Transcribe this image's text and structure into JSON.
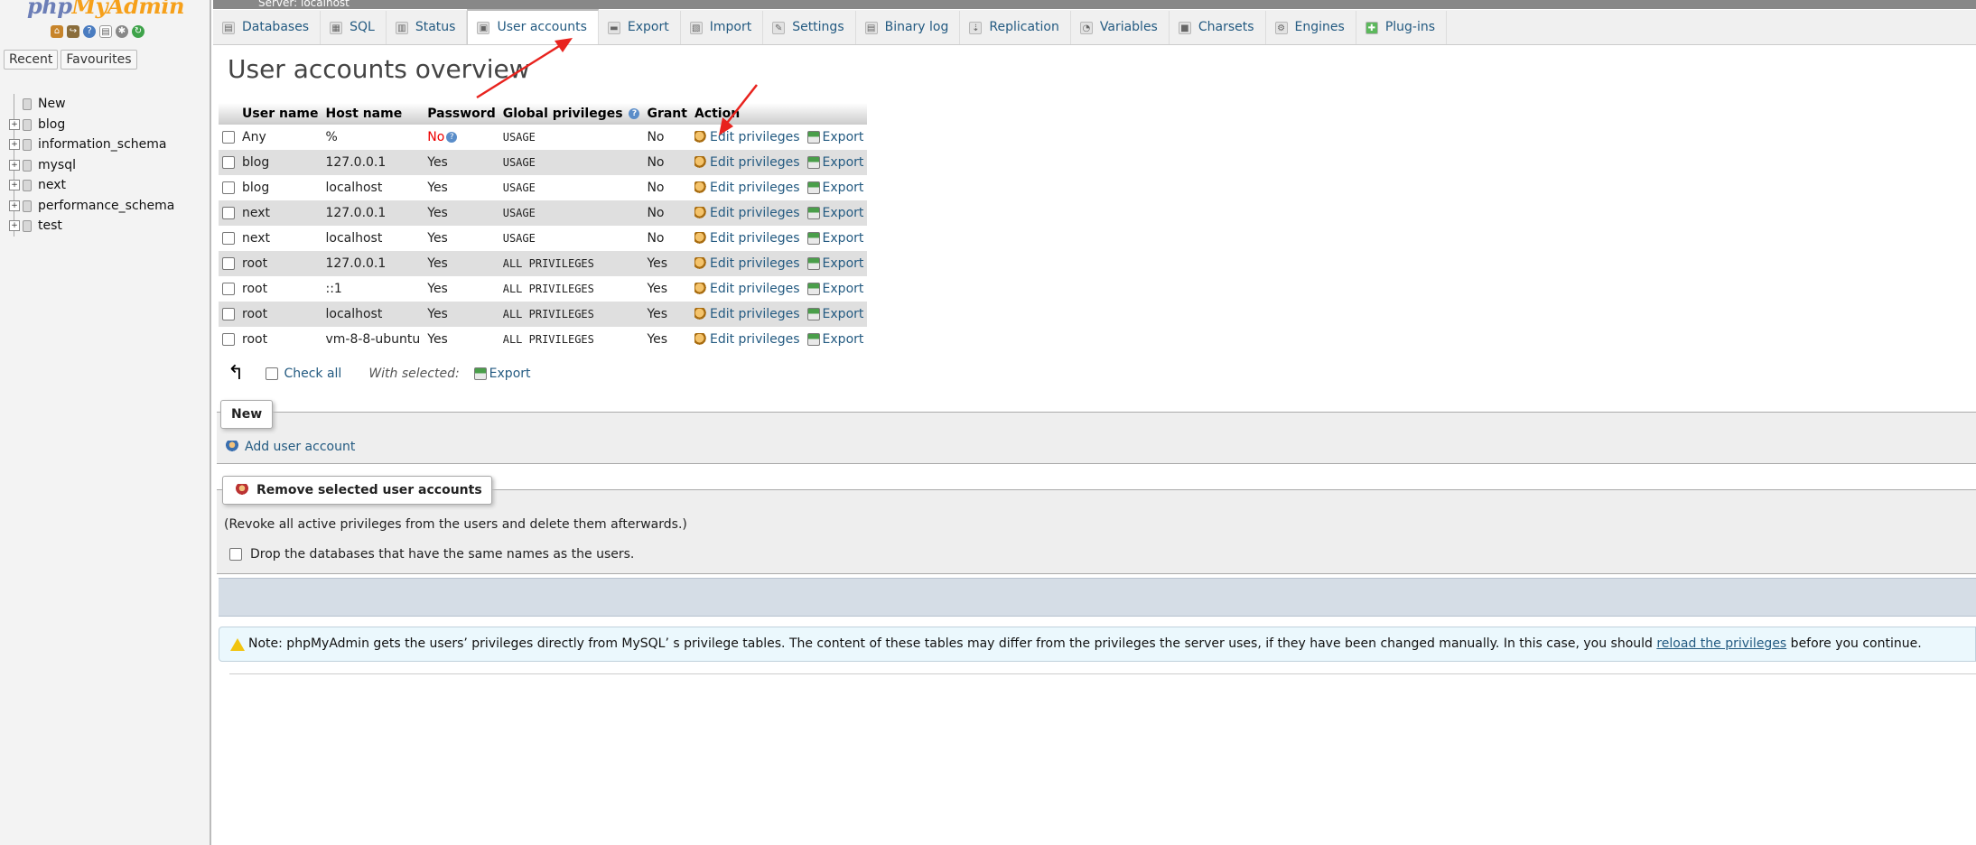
{
  "nav": {
    "logo_php": "php",
    "logo_rest": "MyAdmin",
    "tabs": [
      "Recent",
      "Favourites"
    ],
    "tree": [
      {
        "label": "New",
        "type": "new"
      },
      {
        "label": "blog",
        "type": "db"
      },
      {
        "label": "information_schema",
        "type": "db"
      },
      {
        "label": "mysql",
        "type": "db"
      },
      {
        "label": "next",
        "type": "db"
      },
      {
        "label": "performance_schema",
        "type": "db"
      },
      {
        "label": "test",
        "type": "db"
      }
    ]
  },
  "topbar": {
    "server": "Server: localhost"
  },
  "menu": {
    "tabs": [
      {
        "label": "Databases",
        "icon": "database-icon"
      },
      {
        "label": "SQL",
        "icon": "sql-icon"
      },
      {
        "label": "Status",
        "icon": "status-icon"
      },
      {
        "label": "User accounts",
        "icon": "users-icon",
        "active": true
      },
      {
        "label": "Export",
        "icon": "export-icon"
      },
      {
        "label": "Import",
        "icon": "import-icon"
      },
      {
        "label": "Settings",
        "icon": "settings-icon"
      },
      {
        "label": "Binary log",
        "icon": "binary-log-icon"
      },
      {
        "label": "Replication",
        "icon": "replication-icon"
      },
      {
        "label": "Variables",
        "icon": "variables-icon"
      },
      {
        "label": "Charsets",
        "icon": "charsets-icon"
      },
      {
        "label": "Engines",
        "icon": "engines-icon"
      },
      {
        "label": "Plug-ins",
        "icon": "plugins-icon"
      }
    ]
  },
  "page": {
    "title": "User accounts overview"
  },
  "table": {
    "headers": [
      "User name",
      "Host name",
      "Password",
      "Global privileges",
      "Grant",
      "Action"
    ],
    "action_edit": "Edit privileges",
    "action_export": "Export",
    "rows": [
      {
        "user": "Any",
        "host": "%",
        "password": "No",
        "privileges": "USAGE",
        "grant": "No",
        "user_red": true,
        "password_red": true
      },
      {
        "user": "blog",
        "host": "127.0.0.1",
        "password": "Yes",
        "privileges": "USAGE",
        "grant": "No"
      },
      {
        "user": "blog",
        "host": "localhost",
        "password": "Yes",
        "privileges": "USAGE",
        "grant": "No"
      },
      {
        "user": "next",
        "host": "127.0.0.1",
        "password": "Yes",
        "privileges": "USAGE",
        "grant": "No"
      },
      {
        "user": "next",
        "host": "localhost",
        "password": "Yes",
        "privileges": "USAGE",
        "grant": "No"
      },
      {
        "user": "root",
        "host": "127.0.0.1",
        "password": "Yes",
        "privileges": "ALL PRIVILEGES",
        "grant": "Yes"
      },
      {
        "user": "root",
        "host": "::1",
        "password": "Yes",
        "privileges": "ALL PRIVILEGES",
        "grant": "Yes"
      },
      {
        "user": "root",
        "host": "localhost",
        "password": "Yes",
        "privileges": "ALL PRIVILEGES",
        "grant": "Yes"
      },
      {
        "user": "root",
        "host": "vm-8-8-ubuntu",
        "password": "Yes",
        "privileges": "ALL PRIVILEGES",
        "grant": "Yes"
      }
    ]
  },
  "bulk": {
    "check_all": "Check all",
    "with_selected": "With selected:",
    "export": "Export"
  },
  "new_section": {
    "legend": "New",
    "add_user": "Add user account"
  },
  "remove_section": {
    "legend": "Remove selected user accounts",
    "description": "(Revoke all active privileges from the users and delete them afterwards.)",
    "drop_db_label": "Drop the databases that have the same names as the users."
  },
  "note": {
    "prefix": "Note: phpMyAdmin gets the users’   privileges directly from MySQL’ s privilege tables. The content of these tables may differ from the privileges the server uses, if they have been changed manually. In this case, you should ",
    "link": "reload the privileges",
    "suffix": " before you continue."
  },
  "colors": {
    "accent_link": "#235a81",
    "warning_red": "#e00000",
    "annotation_arrow": "#e8231e"
  }
}
